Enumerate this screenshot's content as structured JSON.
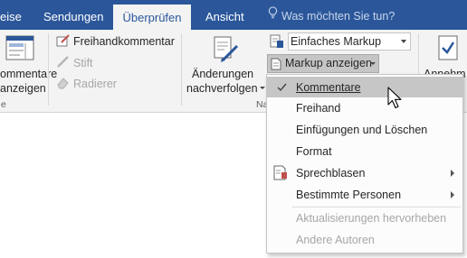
{
  "tabs": [
    {
      "label": "eise",
      "active": false
    },
    {
      "label": "Sendungen",
      "active": false
    },
    {
      "label": "Überprüfen",
      "active": true
    },
    {
      "label": "Ansicht",
      "active": false
    }
  ],
  "tell_me": {
    "text": "Was möchten Sie tun?",
    "icon": "lightbulb-icon"
  },
  "ribbon": {
    "show_comments": {
      "line1": "ommentare",
      "line2": "anzeigen"
    },
    "left_group_label_tail": "e",
    "ink": {
      "freehand": "Freihandkommentar",
      "pen": "Stift",
      "eraser": "Radierer"
    },
    "track_changes": {
      "line1": "Änderungen",
      "line2": "nachverfolgen"
    },
    "tracking_group_label": "Na",
    "markup_combo": {
      "value": "Einfaches Markup"
    },
    "show_markup_button": {
      "label": "Markup anzeigen"
    },
    "accept_partial": "Annehm"
  },
  "dropdown": {
    "items": [
      {
        "label": "Kommentare",
        "accel": "K",
        "checked": true,
        "highlighted": true,
        "enabled": true,
        "submenu": false
      },
      {
        "label": "Freihand",
        "accel": "F",
        "checked": false,
        "highlighted": false,
        "enabled": true,
        "submenu": false
      },
      {
        "label": "Einfügungen und Löschen",
        "accel": "E",
        "checked": false,
        "highlighted": false,
        "enabled": true,
        "submenu": false
      },
      {
        "label": "Format",
        "accel": "t",
        "checked": false,
        "highlighted": false,
        "enabled": true,
        "submenu": false
      },
      {
        "label": "Sprechblasen",
        "accel": "S",
        "checked": false,
        "highlighted": false,
        "enabled": true,
        "submenu": true
      },
      {
        "label": "Bestimmte Personen",
        "accel": "B",
        "checked": false,
        "highlighted": false,
        "enabled": true,
        "submenu": true
      },
      {
        "label": "Aktualisierungen hervorheben",
        "accel": "k",
        "checked": false,
        "highlighted": false,
        "enabled": false,
        "submenu": false
      },
      {
        "label": "Andere Autoren",
        "accel": "o",
        "checked": false,
        "highlighted": false,
        "enabled": false,
        "submenu": false
      }
    ]
  },
  "colors": {
    "ribbon_blue": "#2b579a",
    "ribbon_bg": "#f3f3f3",
    "menu_highlight": "#c6c6c6",
    "disabled_text": "#a6a6a6"
  }
}
